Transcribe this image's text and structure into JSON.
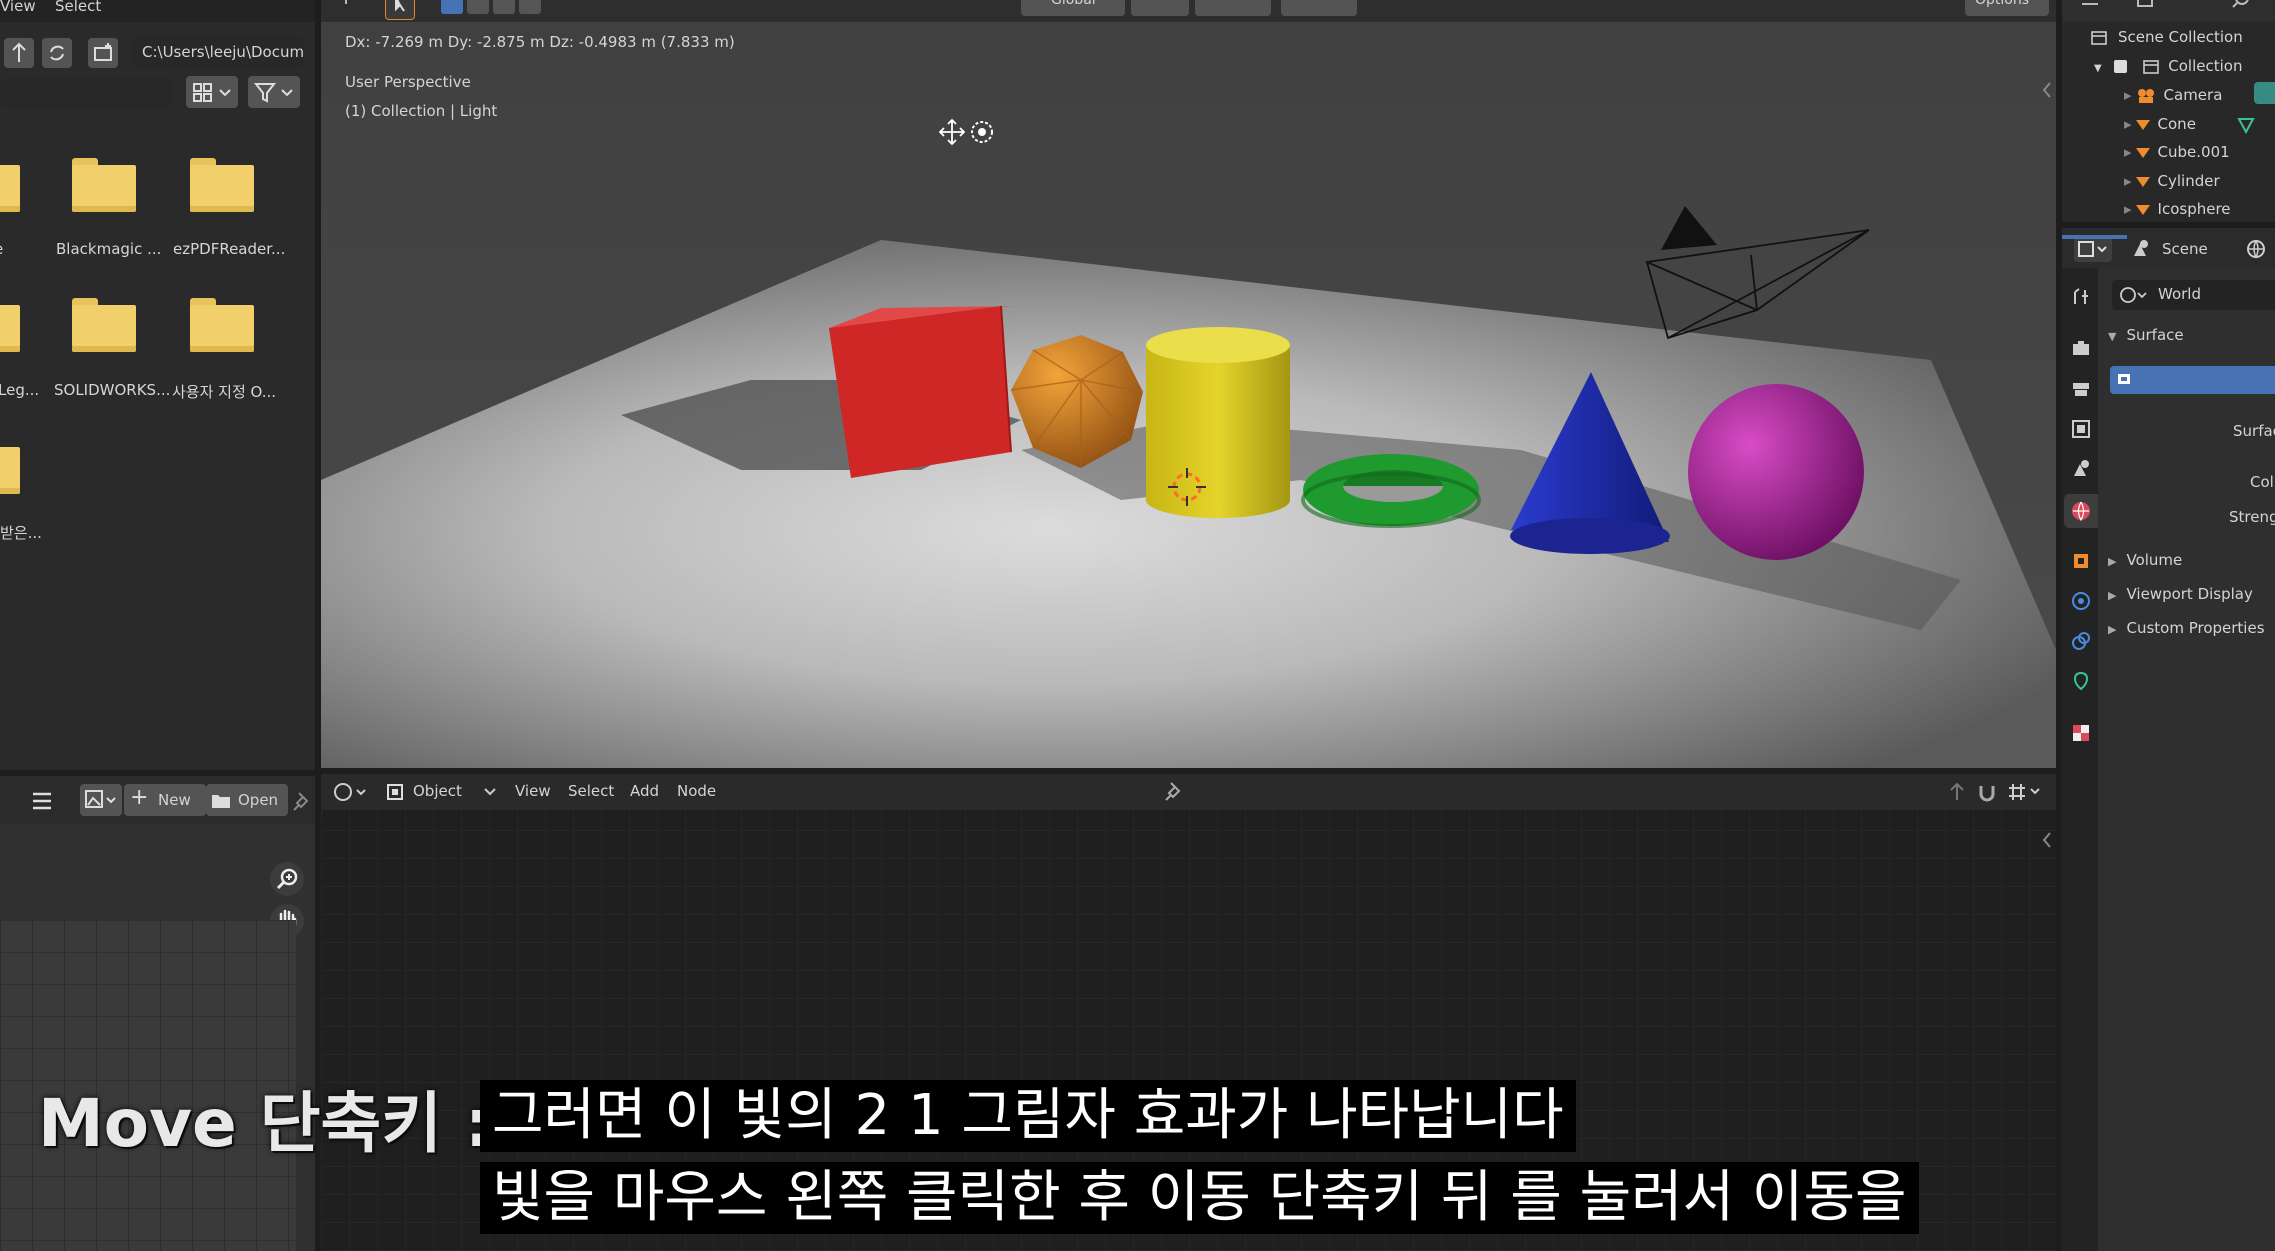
{
  "top_menu": {
    "view": "View",
    "select": "Select"
  },
  "file_browser": {
    "path": "C:\\Users\\leeju\\Docum...",
    "folders": [
      {
        "label": "e"
      },
      {
        "label": "Blackmagic ..."
      },
      {
        "label": "ezPDFReader..."
      },
      {
        "label": "Leg..."
      },
      {
        "label": "SOLIDWORKS..."
      },
      {
        "label": "사용자 지정 O..."
      },
      {
        "label": "받은..."
      }
    ]
  },
  "image_editor": {
    "new_label": "New",
    "open_label": "Open"
  },
  "viewport": {
    "header": {
      "orientation": "Global",
      "options": "Options"
    },
    "transform_readout": "Dx: -7.269 m  Dy: -2.875 m  Dz: -0.4983 m (7.833 m)",
    "perspective": "User Perspective",
    "collection_info": "(1) Collection | Light"
  },
  "node_editor": {
    "mode": "Object",
    "menu": [
      "View",
      "Select",
      "Add",
      "Node"
    ]
  },
  "outliner": {
    "scene_collection": "Scene Collection",
    "collection": "Collection",
    "items": [
      "Camera",
      "Cone",
      "Cube.001",
      "Cylinder",
      "Icosphere"
    ]
  },
  "properties": {
    "scene": "Scene",
    "world": "World",
    "surface_panel": "Surface",
    "surface_field": "Surfac",
    "color_field": "Col",
    "strength_field": "Streng",
    "panels": [
      "Volume",
      "Viewport Display",
      "Custom Properties"
    ]
  },
  "overlay": {
    "shortcut_title": "Move 단축키 : G",
    "subtitle_line1": "그러면 이 빛의 2 1 그림자 효과가 나타납니다",
    "subtitle_line2": "빛을 마우스 왼쪽 클릭한 후 이동 단축키 뒤 를 눌러서 이동을"
  },
  "colors": {
    "cube": "#d92a2a",
    "icosphere": "#e88a22",
    "cylinder": "#d8c81c",
    "torus": "#1f9a2e",
    "cone": "#2232b8",
    "sphere": "#b0209e",
    "selection_blue": "#4772b3"
  }
}
